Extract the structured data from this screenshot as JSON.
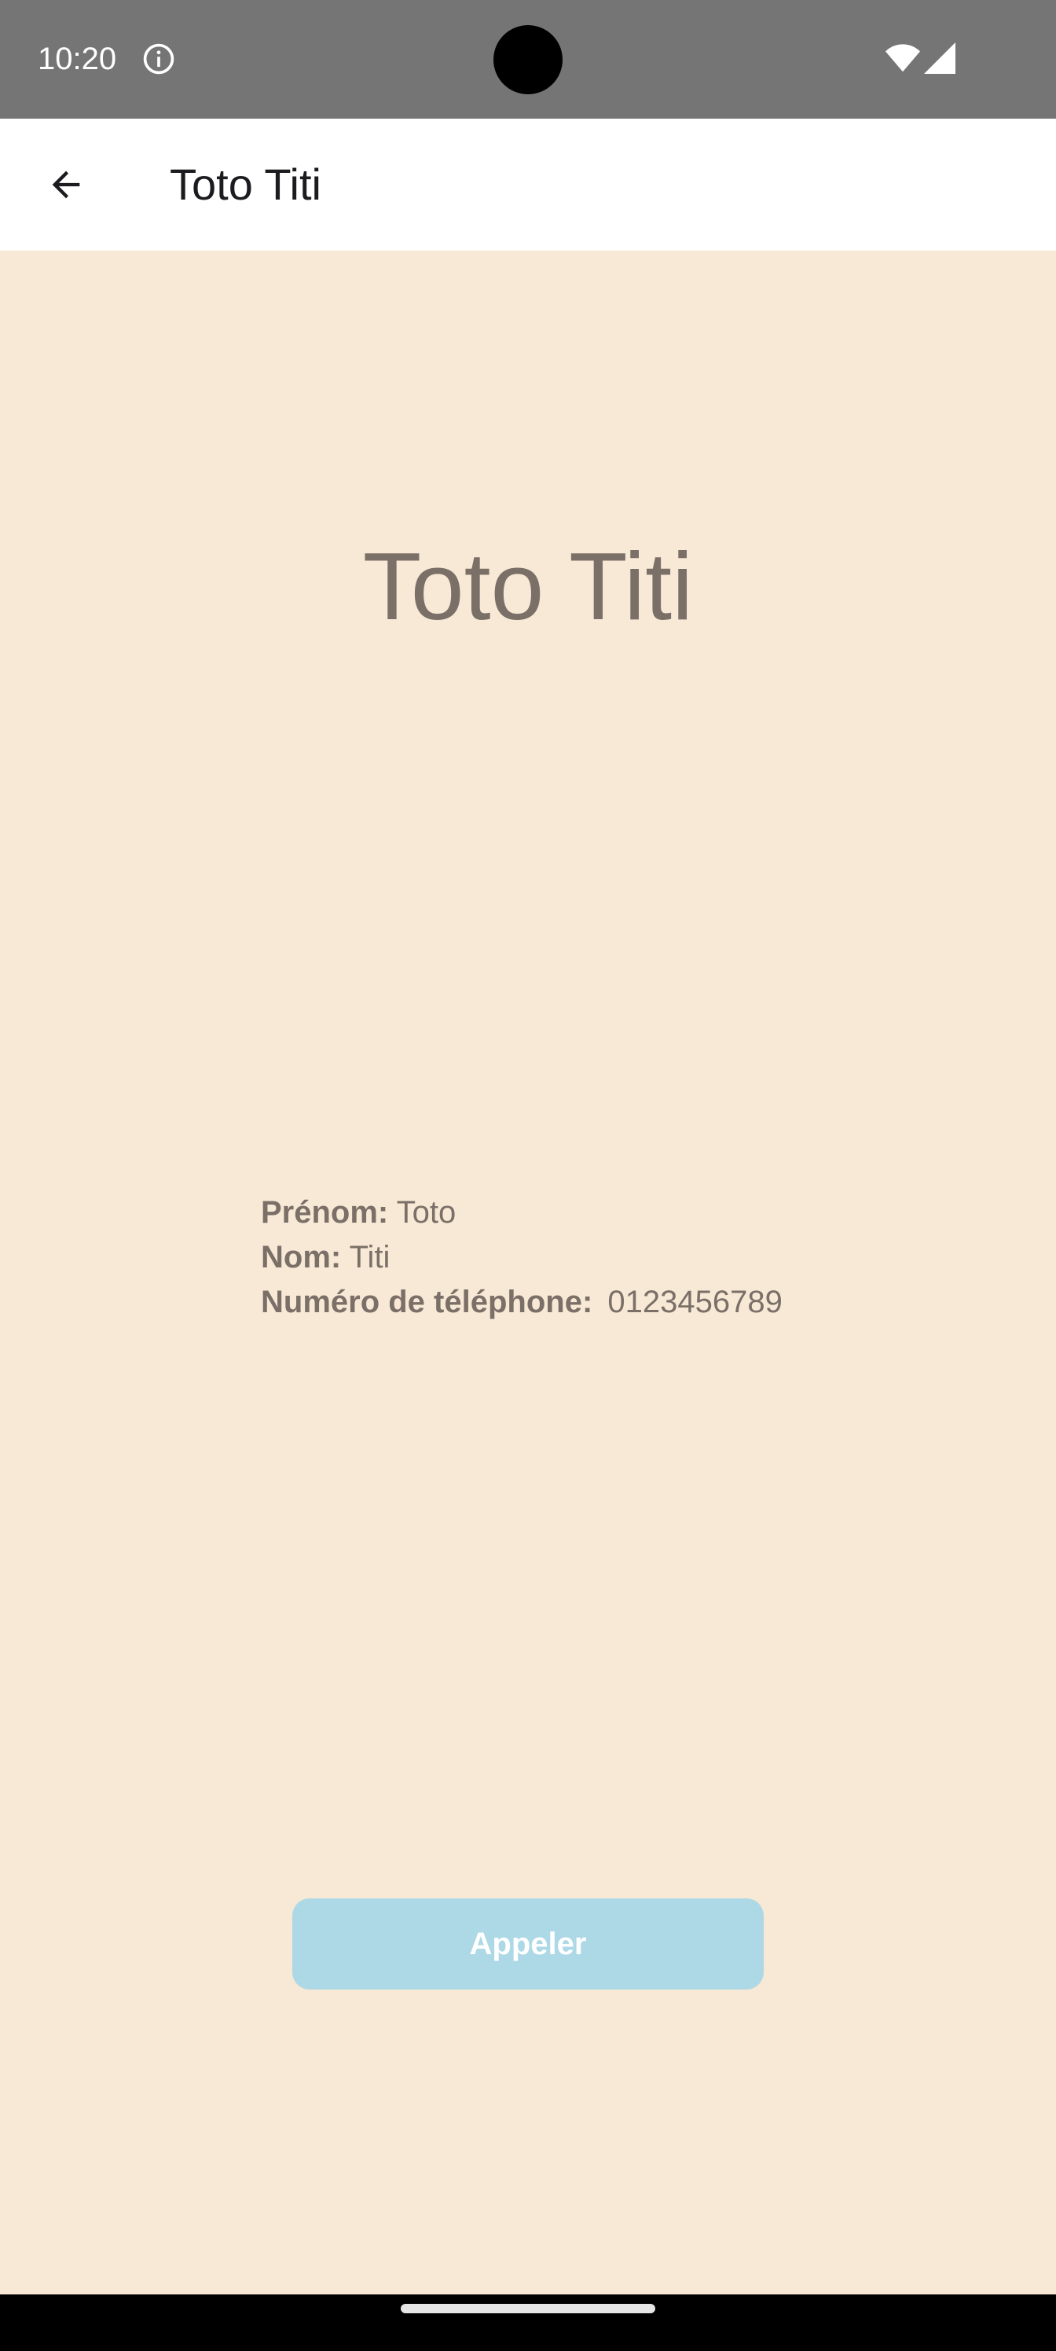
{
  "status_bar": {
    "time": "10:20",
    "icons": [
      "info-icon",
      "wifi-icon",
      "signal-icon"
    ]
  },
  "app_bar": {
    "back_icon": "arrow-back-icon",
    "title": "Toto Titi"
  },
  "contact": {
    "display_name": "Toto Titi",
    "first_name_label": "Prénom:",
    "first_name": "Toto",
    "last_name_label": "Nom:",
    "last_name": "Titi",
    "phone_label": "Numéro de téléphone:",
    "phone": "0123456789"
  },
  "actions": {
    "call_label": "Appeler"
  },
  "colors": {
    "background": "#f8e9d6",
    "status_bar": "#757575",
    "text_muted": "#7b7068",
    "call_button": "#add8e6"
  }
}
